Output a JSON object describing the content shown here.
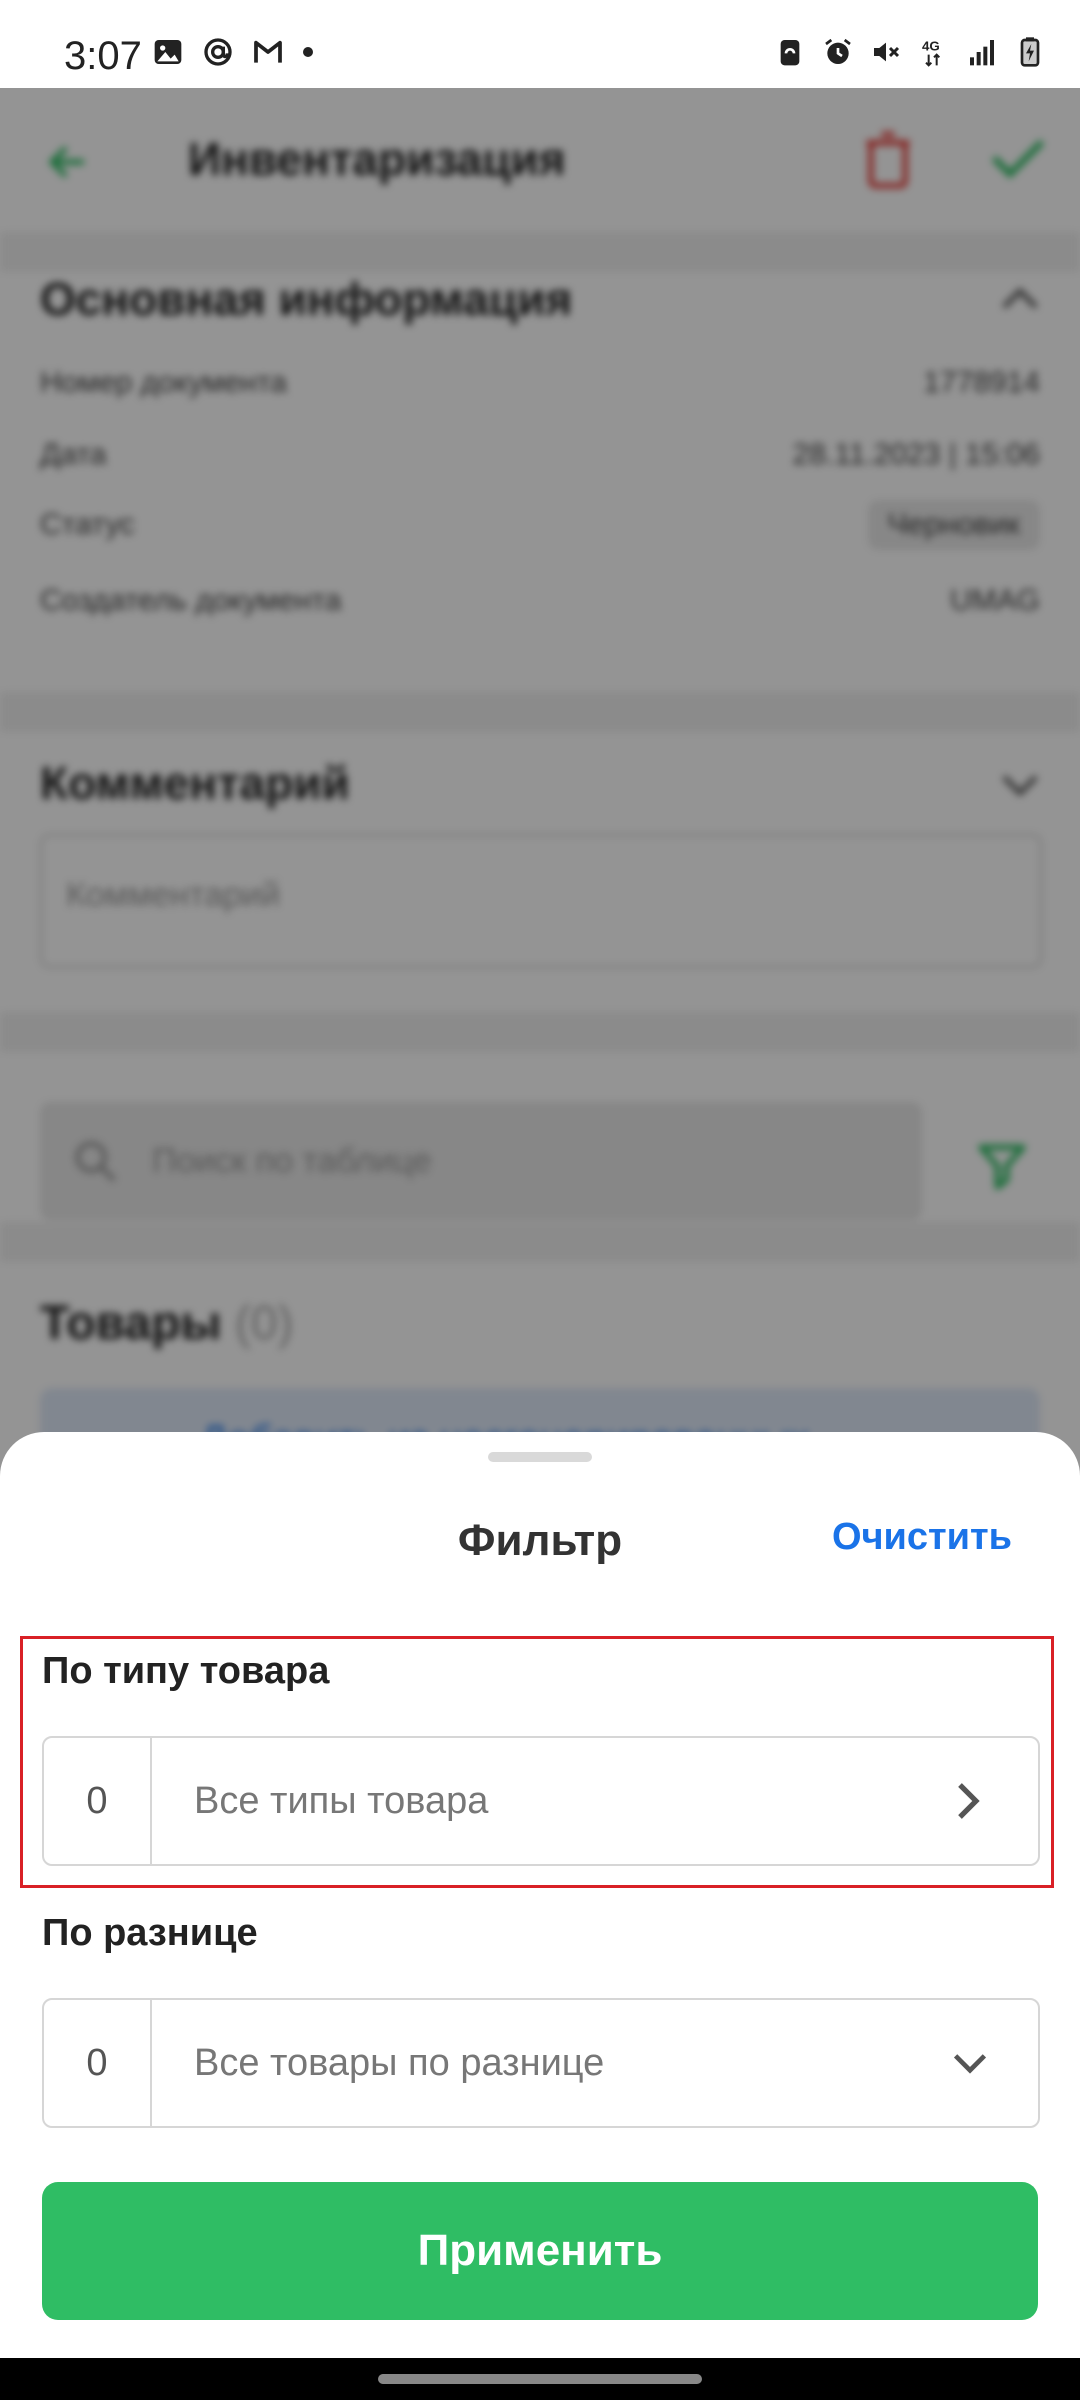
{
  "status_bar": {
    "time": "3:07",
    "left_icons": [
      "gallery-icon",
      "at-icon",
      "gmail-icon",
      "dot-icon"
    ],
    "right_icons": [
      "battery-saver-icon",
      "alarm-icon",
      "mute-icon",
      "4g-icon",
      "signal-icon",
      "battery-charging-icon"
    ]
  },
  "background": {
    "header": {
      "title": "Инвентаризация",
      "back_icon": "arrow-left-icon",
      "delete_icon": "trash-icon",
      "confirm_icon": "check-icon"
    },
    "main_info": {
      "title": "Основная информация",
      "rows": [
        {
          "label": "Номер документа",
          "value": "1778914"
        },
        {
          "label": "Дата",
          "value": "28.11.2023 | 15:06"
        },
        {
          "label": "Статус",
          "value": "Черновик"
        },
        {
          "label": "Создатель документа",
          "value": "UMAG"
        }
      ]
    },
    "comment": {
      "title": "Комментарий",
      "placeholder": "Комментарий"
    },
    "search": {
      "placeholder": "Поиск по таблице"
    },
    "goods": {
      "title": "Товары",
      "count": "(0)",
      "add_label": "Добавить из несгенерированных"
    }
  },
  "sheet": {
    "title": "Фильтр",
    "clear_label": "Очистить",
    "by_type": {
      "label": "По типу товара",
      "count": "0",
      "value": "Все типы товара"
    },
    "by_diff": {
      "label": "По разнице",
      "count": "0",
      "value": "Все товары по разнице"
    },
    "apply_label": "Применить"
  },
  "colors": {
    "accent_green": "#2fbd64",
    "link_blue": "#1a73e8",
    "highlight_red": "#d92026"
  }
}
